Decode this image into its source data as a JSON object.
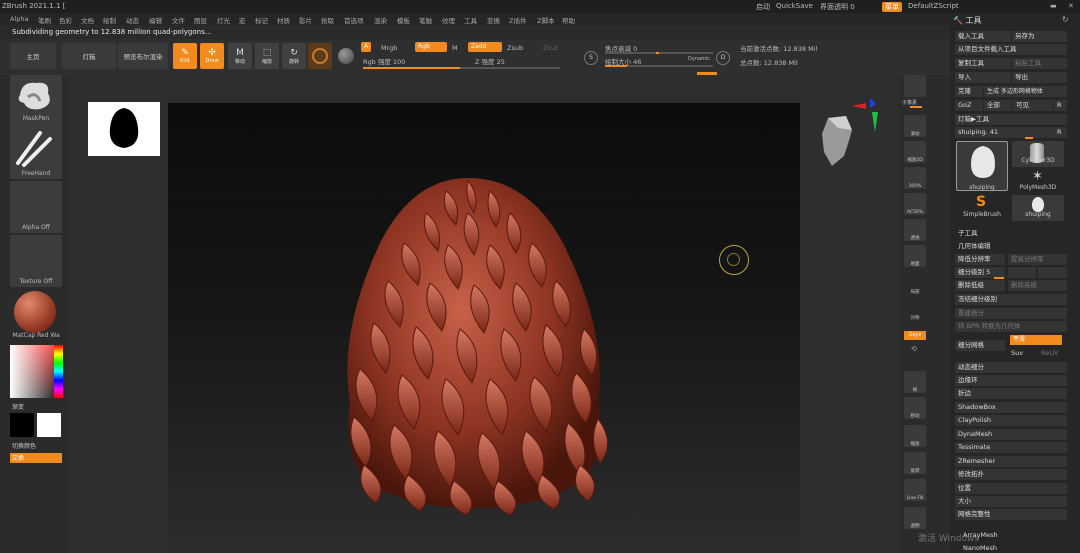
{
  "titlebar": {
    "app_title": "ZBrush 2021.1.1 [",
    "menu_label": "启动",
    "quicksave": "QuickSave",
    "transparency": "界面透明 0",
    "menu_btn": "菜单",
    "script": "DefaultZScript"
  },
  "menubar": [
    "Alpha",
    "笔刷",
    "色彩",
    "文档",
    "绘制",
    "动态",
    "编辑",
    "文件",
    "图层",
    "灯光",
    "宏",
    "标记",
    "材质",
    "影片",
    "拾取",
    "首选项",
    "渲染",
    "模板",
    "笔触",
    "纹理",
    "工具",
    "变换",
    "Z插件",
    "Z脚本",
    "帮助"
  ],
  "status": "Subdividing geometry to 12.838 million quad-polygons...",
  "toolbar": {
    "home": "主页",
    "lightbox": "灯箱",
    "preview": "预览布尔渲染",
    "edit": "Edit",
    "draw": "Draw",
    "move": "移动",
    "scale": "缩放",
    "rotate": "旋转",
    "a": "A",
    "mrgb": "Mrgb",
    "rgb": "Rgb",
    "m": "M",
    "zadd": "Zadd",
    "zsub": "Zsub",
    "zcut": "Zcut",
    "rgb_intensity": "Rgb 强度 100",
    "z_intensity": "Z 强度 25",
    "focal_shift": "焦点衰减 0",
    "draw_size": "绘制大小 46",
    "dynamic": "Dynamic",
    "active_points": "当前激活点数: 12.838 Mil",
    "total_points": "总点数: 12.838 Mil"
  },
  "leftpanel": {
    "brush": "MaskPen",
    "stroke": "FreeHand",
    "alpha": "Alpha Off",
    "texture": "Texture Off",
    "material": "MatCap Red Wa",
    "gradient": "渐变",
    "switch_color": "切换颜色",
    "alternate": "交换"
  },
  "rightstrip": [
    "子像素",
    "滚动",
    "缩放2D",
    "100%",
    "AC50%",
    "透视",
    "地面",
    "局部",
    "对称",
    "Gxyz",
    "",
    "帧",
    "移动",
    "缩放",
    "旋转",
    "Line Fill",
    "透明"
  ],
  "rightpanel": {
    "header": "工具",
    "load": "载入工具",
    "save_as": "另存为",
    "load_project": "从项目文件载入工具",
    "copy": "复制工具",
    "paste": "粘贴工具",
    "import": "导入",
    "export": "导出",
    "clone": "克隆",
    "make_polymesh": "生成 多边形网格物体",
    "goz": "GoZ",
    "all": "全部",
    "visible": "可见",
    "r": "R",
    "lightbox_tool": "灯箱▶工具",
    "current_tool": "shuiping. 41",
    "thumbs": [
      "shuiping",
      "Cylinder3D",
      "PolyMesh3D",
      "SimpleBrush",
      "shuiping"
    ],
    "subtool": "子工具",
    "geometry": "几何体编辑",
    "lower_res": "降低分辨率",
    "higher_res": "提高分辨率",
    "sdiv": "细分级别 5",
    "del_lower": "删除低级",
    "del_higher": "删除高级",
    "freeze": "冻结细分级别",
    "reconstruct": "重建细分",
    "convert_bpr": "将 BPR 转换为几何体",
    "divide": "细分网格",
    "smooth": "平滑",
    "suv": "Suv",
    "reuv": "ReUV",
    "dynamic_sub": "动态细分",
    "edge_loop": "边缘环",
    "crease": "折边",
    "shadowbox": "ShadowBox",
    "claypolish": "ClayPolish",
    "dynamesh": "DynaMesh",
    "tessimate": "Tessimate",
    "zremesher": "ZRemesher",
    "modify_topo": "修改拓扑",
    "position": "位置",
    "size": "大小",
    "mesh_integrity": "网格完整性",
    "arraymesh": "ArrayMesh",
    "nanomesh": "NanoMesh"
  },
  "watermark": "激活 Windows"
}
